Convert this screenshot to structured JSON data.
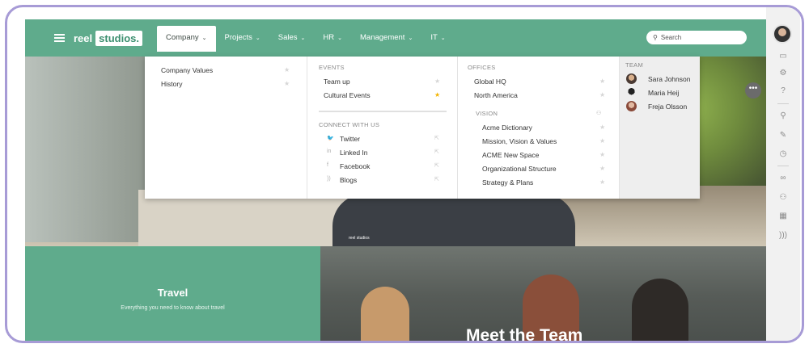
{
  "brand": {
    "logo_part1": "reel",
    "logo_part2": "studios."
  },
  "nav": [
    {
      "label": "Company",
      "caret": "⌄"
    },
    {
      "label": "Projects",
      "caret": "⌄"
    },
    {
      "label": "Sales",
      "caret": "⌄"
    },
    {
      "label": "HR",
      "caret": "⌄"
    },
    {
      "label": "Management",
      "caret": "⌄"
    },
    {
      "label": "IT",
      "caret": "⌄"
    }
  ],
  "search": {
    "placeholder": "Search",
    "icon": "search-icon"
  },
  "dropdown": {
    "col1": {
      "items": [
        {
          "label": "Company Values",
          "starred": false
        },
        {
          "label": "History",
          "starred": false
        }
      ]
    },
    "events": {
      "heading": "EVENTS",
      "items": [
        {
          "label": "Team up",
          "starred": false
        },
        {
          "label": "Cultural Events",
          "starred": true
        }
      ]
    },
    "connect": {
      "heading": "CONNECT WITH US",
      "items": [
        {
          "label": "Twitter",
          "icon": "twitter-icon"
        },
        {
          "label": "Linked In",
          "icon": "linkedin-icon"
        },
        {
          "label": "Facebook",
          "icon": "facebook-icon"
        },
        {
          "label": "Blogs",
          "icon": "blog-icon"
        }
      ]
    },
    "offices": {
      "heading": "OFFICES",
      "items": [
        {
          "label": "Global HQ"
        },
        {
          "label": "North America"
        }
      ]
    },
    "vision": {
      "heading": "VISION",
      "items": [
        {
          "label": "Acme Dictionary"
        },
        {
          "label": "Mission, Vision & Values"
        },
        {
          "label": "ACME New Space"
        },
        {
          "label": "Organizational Structure"
        },
        {
          "label": "Strategy & Plans"
        }
      ]
    },
    "team": {
      "heading": "TEAM",
      "members": [
        {
          "name": "Sara Johnson"
        },
        {
          "name": "Maria Heij"
        },
        {
          "name": "Freja Olsson"
        }
      ]
    }
  },
  "travel": {
    "title": "Travel",
    "subtitle": "Everything you need to know about travel"
  },
  "team_banner": {
    "title": "Meet the Team"
  },
  "hero": {
    "tag": "reel studios"
  },
  "colors": {
    "accent": "#5fab8c",
    "star_on": "#f3b400",
    "frame": "#a79bd6"
  },
  "rail_icons": [
    "user-avatar",
    "inbox-icon",
    "gear-icon",
    "help-icon",
    "search-icon",
    "edit-icon",
    "clock-icon",
    "link-icon",
    "people-icon",
    "calendar-icon",
    "rss-icon"
  ]
}
